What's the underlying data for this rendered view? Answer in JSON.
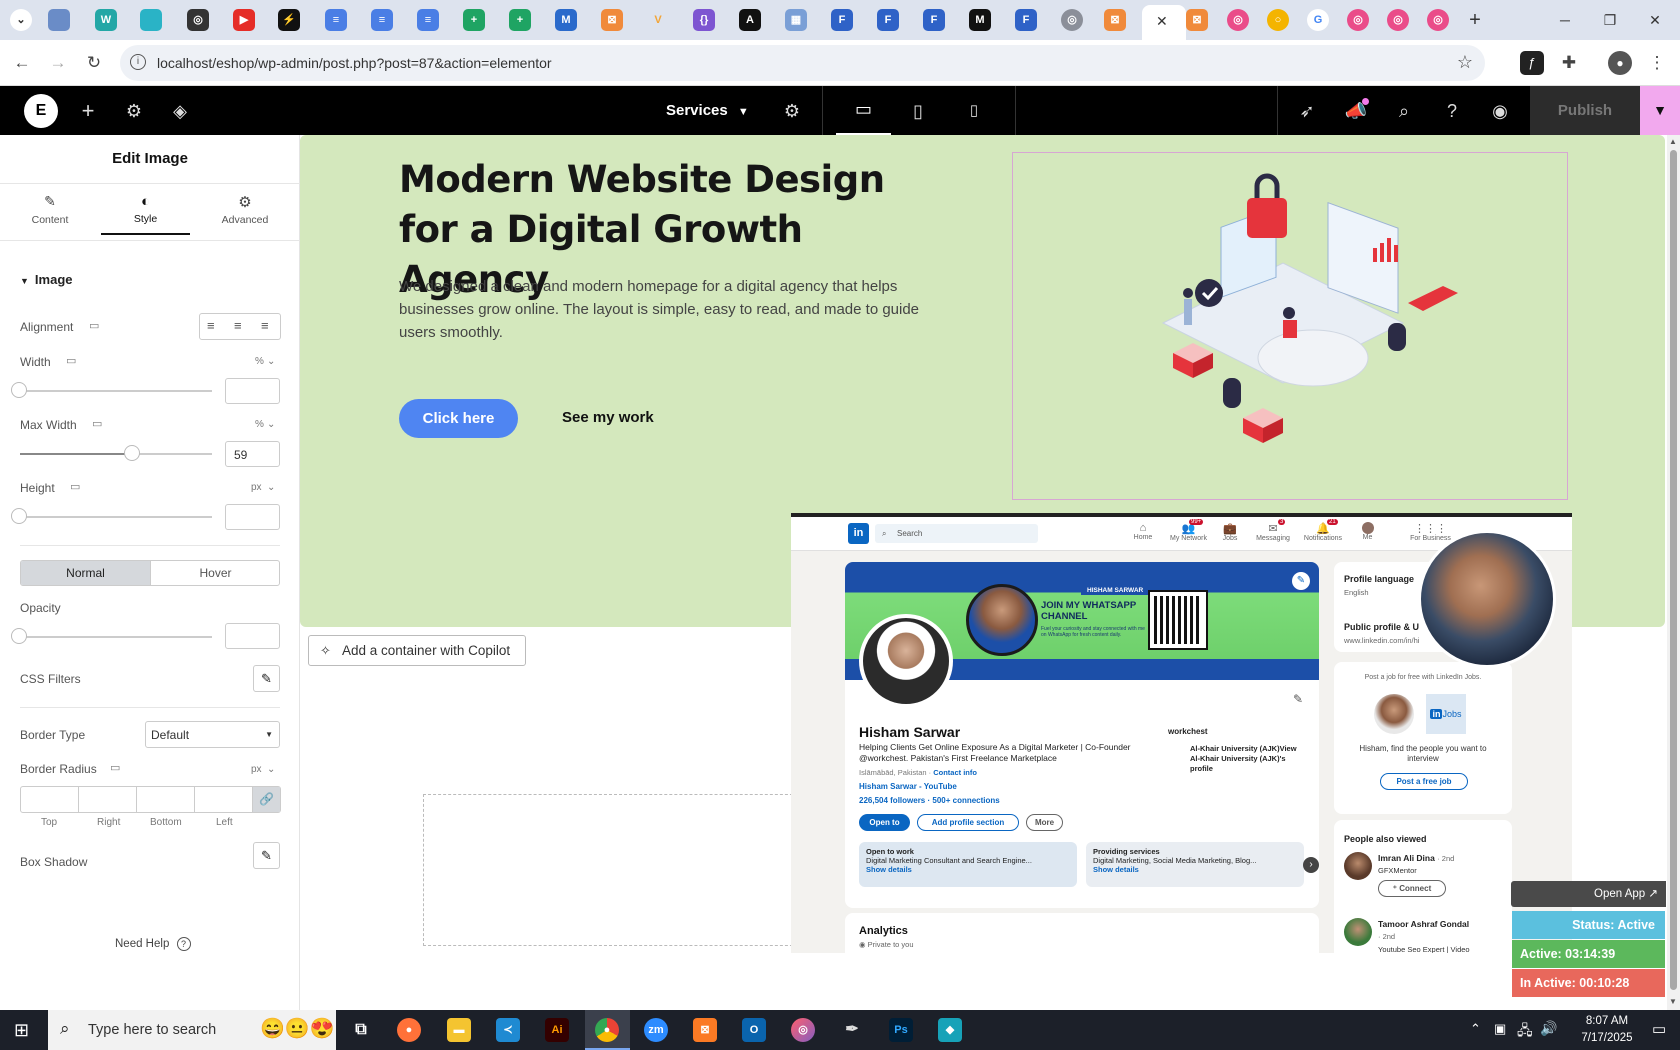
{
  "browser": {
    "url": "localhost/eshop/wp-admin/post.php?post=87&action=elementor",
    "tab_close": "✕",
    "new_tab": "+"
  },
  "elementor_bar": {
    "page_name": "Services",
    "publish_label": "Publish"
  },
  "panel": {
    "title": "Edit Image",
    "tabs": [
      {
        "label": "Content"
      },
      {
        "label": "Style"
      },
      {
        "label": "Advanced"
      }
    ],
    "section_title": "Image",
    "alignment_label": "Alignment",
    "width_label": "Width",
    "width_unit": "%",
    "width_value": "",
    "max_width_label": "Max Width",
    "max_width_unit": "%",
    "max_width_value": "59",
    "height_label": "Height",
    "height_unit": "px",
    "height_value": "",
    "state_tabs": [
      "Normal",
      "Hover"
    ],
    "opacity_label": "Opacity",
    "opacity_value": "",
    "css_filters_label": "CSS Filters",
    "border_type_label": "Border Type",
    "border_type_value": "Default",
    "border_radius_label": "Border Radius",
    "border_radius_unit": "px",
    "radius_sides": [
      "Top",
      "Right",
      "Bottom",
      "Left"
    ],
    "box_shadow_label": "Box Shadow",
    "need_help": "Need Help"
  },
  "canvas": {
    "hero_title": "Modern Website Design for a Digital Growth Agency",
    "hero_text": "We designed a clean and modern homepage for a digital agency that helps businesses grow online. The layout is simple, easy to read, and made to guide users smoothly.",
    "primary_button": "Click here",
    "secondary_button": "See my work",
    "copilot_button": "Add a container with Copilot"
  },
  "linkedin": {
    "search_placeholder": "Search",
    "nav": [
      {
        "label": "Home",
        "badge": ""
      },
      {
        "label": "My Network",
        "badge": "99+"
      },
      {
        "label": "Jobs",
        "badge": ""
      },
      {
        "label": "Messaging",
        "badge": "3"
      },
      {
        "label": "Notifications",
        "badge": "21"
      },
      {
        "label": "Me",
        "badge": ""
      },
      {
        "label": "For Business",
        "badge": ""
      }
    ],
    "banner_tag": "HISHAM SARWAR",
    "banner_title": "JOIN MY WHATSAPP CHANNEL",
    "banner_sub": "Fuel your curiosity and stay connected with me on WhatsApp for fresh content daily.",
    "name": "Hisham Sarwar",
    "headline": "Helping Clients Get Online Exposure As a Digital Marketer | Co-Founder @workchest. Pakistan's First Freelance Marketplace",
    "location": "Islāmābād, Pakistan",
    "contact": "Contact info",
    "youtube": "Hisham Sarwar - YouTube",
    "followers": "226,504 followers",
    "connections": "500+ connections",
    "company": "workchest",
    "university": "Al-Khair University (AJK)View Al-Khair University (AJK)'s profile",
    "btn_open": "Open to",
    "btn_add": "Add profile section",
    "btn_more": "More",
    "open_to_work_title": "Open to work",
    "open_to_work_text": "Digital Marketing Consultant and Search Engine...",
    "providing_title": "Providing services",
    "providing_text": "Digital Marketing, Social Media Marketing, Blog...",
    "show_details": "Show details",
    "analytics": "Analytics",
    "private": "Private to you",
    "profile_language": "Profile language",
    "english": "English",
    "public_profile": "Public profile & U",
    "public_url": "www.linkedin.com/in/hi",
    "post_job_text": "Post a job for free with LinkedIn Jobs.",
    "jobs": "Jobs",
    "find_people": "Hisham, find the people you want to interview",
    "post_free_job": "Post a free job",
    "people_viewed": "People also viewed",
    "person1_name": "Imran Ali Dina",
    "person1_degree": "· 2nd",
    "person1_title": "GFXMentor",
    "connect": "Connect",
    "person2_name": "Tamoor Ashraf Gondal",
    "person2_degree": "· 2nd",
    "person2_title": "Youtube Seo Expert | Video"
  },
  "widgets": {
    "open_app": "Open App ↗",
    "status": "Status: Active",
    "active": "Active: 03:14:39",
    "inactive": "In Active: 00:10:28"
  },
  "taskbar": {
    "search_placeholder": "Type here to search",
    "time": "8:07 AM",
    "date": "7/17/2025"
  }
}
